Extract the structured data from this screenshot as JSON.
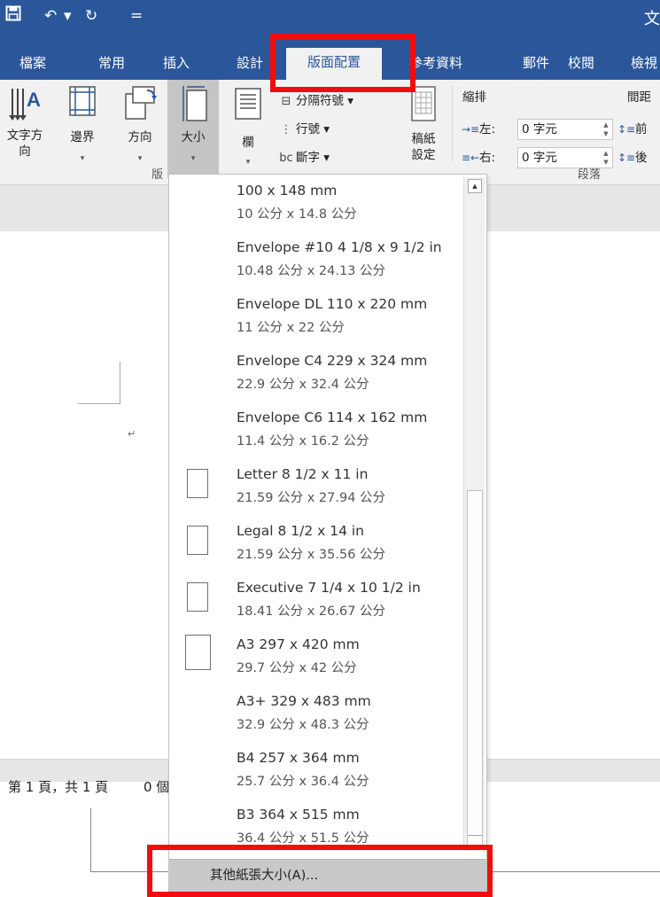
{
  "titlebar": {
    "title": "文",
    "icons": {
      "save": "save-icon",
      "undo": "undo-icon",
      "redo": "redo-icon",
      "customize": "customize-quick-access-icon"
    },
    "glyphs": {
      "undo": "↶",
      "undo_arrow": "▾",
      "redo": "↻",
      "customize": "="
    },
    "colors": {
      "brand": "#2b579a"
    }
  },
  "tabs": {
    "file": "檔案",
    "home": "常用",
    "insert": "插入",
    "design": "設計",
    "layout": "版面配置",
    "references": "參考資料",
    "mailings": "郵件",
    "review": "校閱",
    "view": "檢視",
    "active": "layout"
  },
  "ribbon": {
    "text_direction": {
      "line1": "文字方",
      "line2": "向"
    },
    "margins": "邊界",
    "orientation": "方向",
    "size": "大小",
    "columns": "欄",
    "breaks": "分隔符號",
    "line_numbers": "行號",
    "hyphenation": "斷字",
    "draft_paper": {
      "line1": "稿紙",
      "line2": "設定"
    },
    "indent": {
      "title": "縮排",
      "left_label": "左:",
      "left_value": "0 字元",
      "right_label": "右:",
      "right_value": "0 字元"
    },
    "spacing": {
      "title": "間距",
      "before_label": "前",
      "after_label": "後"
    },
    "group_page_setup": "版",
    "group_paragraph": "段落",
    "dropdown_arrow": "▾",
    "spin_arrows": {
      "up": "▲",
      "down": "▼"
    },
    "small_icons": {
      "breaks": "⊟",
      "line_numbers": "⋮",
      "hyphenation": "bc"
    }
  },
  "document": {
    "paragraph_mark": "↵"
  },
  "status": {
    "page": "第 1 頁，共 1 頁",
    "words": "0 個"
  },
  "size_dropdown": {
    "items": [
      {
        "name": "100 x 148 mm",
        "dims": "10 公分 x 14.8 公分",
        "icon": false
      },
      {
        "name": "Envelope #10 4 1/8 x 9 1/2 in",
        "dims": "10.48 公分 x 24.13 公分",
        "icon": false
      },
      {
        "name": "Envelope DL  110 x 220 mm",
        "dims": "11 公分 x 22 公分",
        "icon": false
      },
      {
        "name": "Envelope C4  229 x 324 mm",
        "dims": "22.9 公分 x 32.4 公分",
        "icon": false
      },
      {
        "name": "Envelope C6  114 x 162 mm",
        "dims": "11.4 公分 x 16.2 公分",
        "icon": false
      },
      {
        "name": "Letter 8 1/2 x 11 in",
        "dims": "21.59 公分 x 27.94 公分",
        "icon": true
      },
      {
        "name": "Legal 8 1/2 x 14 in",
        "dims": "21.59 公分 x 35.56 公分",
        "icon": true
      },
      {
        "name": "Executive 7 1/4 x 10 1/2 in",
        "dims": "18.41 公分 x 26.67 公分",
        "icon": true
      },
      {
        "name": "A3 297 x 420 mm",
        "dims": "29.7 公分 x 42 公分",
        "icon": true
      },
      {
        "name": "A3+ 329 x 483 mm",
        "dims": "32.9 公分 x 48.3 公分",
        "icon": false
      },
      {
        "name": "B4 257 x 364 mm",
        "dims": "25.7 公分 x 36.4 公分",
        "icon": false
      },
      {
        "name": "B3 364 x 515 mm",
        "dims": "36.4 公分 x 51.5 公分",
        "icon": false
      }
    ],
    "more_sizes": "其他紙張大小(A)...",
    "scroll_up_glyph": "▲"
  },
  "annotations": {
    "highlight_color": "#f10d0d"
  }
}
